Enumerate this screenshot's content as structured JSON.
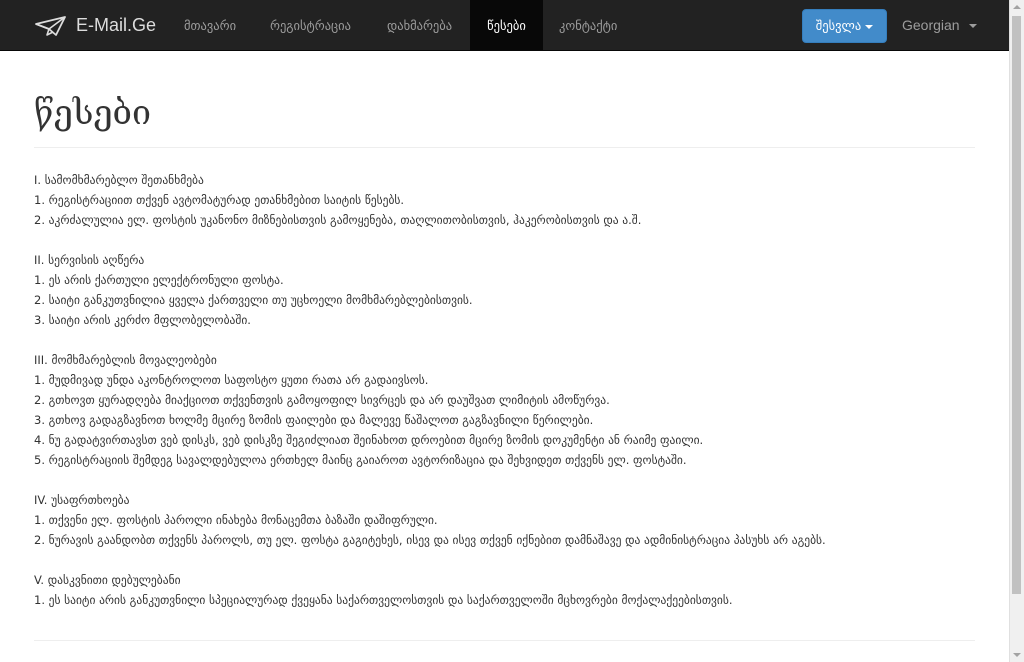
{
  "navbar": {
    "brand": "E-Mail.Ge",
    "items": [
      {
        "label": "მთავარი",
        "active": false
      },
      {
        "label": "რეგისტრაცია",
        "active": false
      },
      {
        "label": "დახმარება",
        "active": false
      },
      {
        "label": "წესები",
        "active": true
      },
      {
        "label": "კონტაქტი",
        "active": false
      }
    ],
    "login_label": "შესვლა",
    "language": "Georgian"
  },
  "page": {
    "title": "წესები",
    "sections": [
      {
        "heading": "I. სამომხმარებლო შეთანხმება",
        "lines": [
          "1. რეგისტრაციით თქვენ ავტომატურად ეთანხმებით საიტის წესებს.",
          "2. აკრძალულია ელ. ფოსტის უკანონო მიზნებისთვის გამოყენება, თაღლითობისთვის, ჰაკერობისთვის და ა.შ."
        ]
      },
      {
        "heading": "II. სერვისის აღწერა",
        "lines": [
          "1. ეს არის ქართული ელექტრონული ფოსტა.",
          "2. საიტი განკუთვნილია ყველა ქართველი თუ უცხოელი მომხმარებლებისთვის.",
          "3. საიტი არის კერძო მფლობელობაში."
        ]
      },
      {
        "heading": "III. მომხმარებლის მოვალეობები",
        "lines": [
          "1. მუდმივად უნდა აკონტროლოთ საფოსტო ყუთი რათა არ გადაივსოს.",
          "2. გთხოვთ ყურადღება მიაქციოთ თქვენთვის გამოყოფილ სივრცეს და არ დაუშვათ ლიმიტის ამოწურვა.",
          "3. გთხოვ გადაგზავნოთ ხოლმე მცირე ზომის ფაილები და მალევე წაშალოთ გაგზავნილი წერილები.",
          "4. ნუ გადატვირთავსთ ვებ დისკს, ვებ დისკზე შეგიძლიათ შეინახოთ დროებით მცირე ზომის დოკუმენტი ან რაიმე ფაილი.",
          "5. რეგისტრაციის შემდეგ სავალდებულოა ერთხელ მაინც გაიაროთ ავტორიზაცია და შეხვიდეთ თქვენს ელ. ფოსტაში."
        ]
      },
      {
        "heading": "IV. უსაფრთხოება",
        "lines": [
          "1. თქვენი ელ. ფოსტის პაროლი ინახება მონაცემთა ბაზაში დაშიფრული.",
          "2. ნურავის გაანდობთ თქვენს პაროლს, თუ ელ. ფოსტა გაგიტეხეს, ისევ და ისევ თქვენ იქნებით დამნაშავე და ადმინისტრაცია პასუხს არ აგებს."
        ]
      },
      {
        "heading": "V. დასკვნითი დებულებანი",
        "lines": [
          "1. ეს საიტი არის განკუთვნილი სპეციალურად ქვეყანა საქართველოსთვის და საქართველოში მცხოვრები მოქალაქეებისთვის."
        ]
      }
    ]
  },
  "colors": {
    "navbar_bg": "#222222",
    "nav_active_bg": "#080808",
    "login_button": "#428bca"
  },
  "icons": {
    "brand": "envelope-logo-icon",
    "dropdown": "caret-down-icon"
  }
}
